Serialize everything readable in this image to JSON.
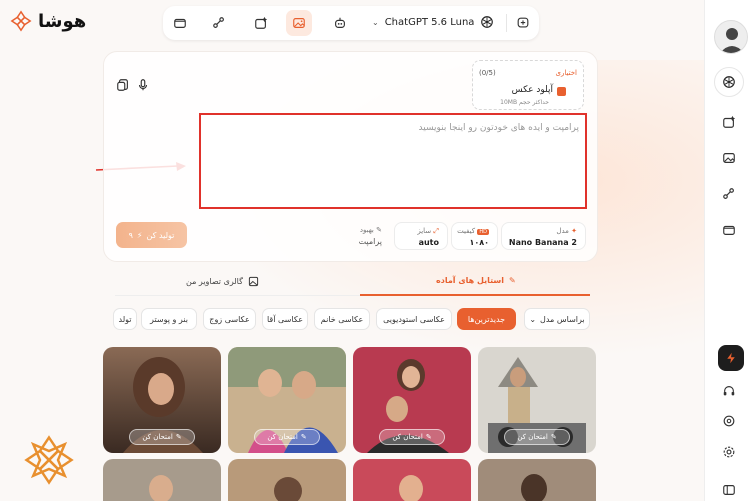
{
  "brand": {
    "name": "هوشا",
    "accent": "#e8602f"
  },
  "topbar": {
    "tools": [
      "chat-bubble-plus-icon",
      "robot-icon",
      "image-edit-icon",
      "video-spark-icon",
      "flow-icon",
      "folder-icon"
    ],
    "active_tool": "image-edit-icon",
    "model_label": "ChatGPT 5.6 Luna"
  },
  "upload": {
    "optional_label": "اختیاری",
    "count": "(0/5)",
    "title": "آپلود عکس",
    "subtitle": "حداکثر حجم 10MB"
  },
  "prompt": {
    "placeholder": "پرامپت و ایده های خودتون رو اینجا بنویسید"
  },
  "params": {
    "model_label": "مدل",
    "model_value": "Nano Banana 2",
    "quality_label": "کیفیت",
    "quality_value": "۱۰۸۰",
    "size_label": "سایز",
    "size_value": "auto",
    "improve_label": "بهبود",
    "improve_value": "پرامپت"
  },
  "generate": {
    "label": "تولید کن",
    "cost": "۹"
  },
  "tabs": {
    "ready_styles": "استایل های آماده",
    "my_gallery": "گالری تصاویر من"
  },
  "filters": {
    "sort_label": "براساس مدل",
    "chips": [
      "جدیدترین‌ها",
      "عکاسی استودیویی",
      "عکاسی خانم",
      "عکاسی آقا",
      "عکاسی زوج",
      "بنر و پوستر",
      "تولد"
    ],
    "active": "جدیدترین‌ها"
  },
  "gallery": {
    "try_label": "امتحان کن"
  },
  "sidebar": {
    "icons": [
      "openai-icon",
      "video-spark-icon",
      "image-edit-icon",
      "flow-icon",
      "folder-icon",
      "lightning-icon",
      "headset-icon",
      "badge-icon",
      "settings-icon",
      "collapse-icon"
    ]
  }
}
